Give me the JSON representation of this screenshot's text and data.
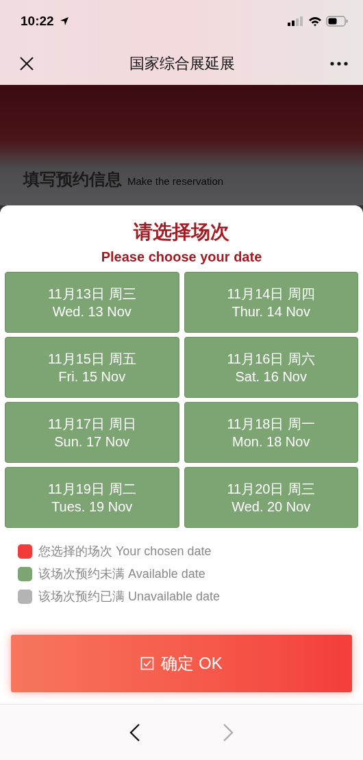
{
  "status_bar": {
    "time": "10:22"
  },
  "nav": {
    "title": "国家综合展延展"
  },
  "background": {
    "heading": "填写预约信息",
    "subheading": "Make the reservation"
  },
  "sheet": {
    "title": "请选择场次",
    "subtitle": "Please choose your date",
    "dates": [
      {
        "zh": "11月13日 周三",
        "en": "Wed. 13 Nov",
        "available": true
      },
      {
        "zh": "11月14日 周四",
        "en": "Thur. 14 Nov",
        "available": true
      },
      {
        "zh": "11月15日 周五",
        "en": "Fri. 15 Nov",
        "available": true
      },
      {
        "zh": "11月16日 周六",
        "en": "Sat. 16 Nov",
        "available": true
      },
      {
        "zh": "11月17日 周日",
        "en": "Sun. 17 Nov",
        "available": true
      },
      {
        "zh": "11月18日 周一",
        "en": "Mon. 18 Nov",
        "available": true
      },
      {
        "zh": "11月19日 周二",
        "en": "Tues. 19 Nov",
        "available": true
      },
      {
        "zh": "11月20日 周三",
        "en": "Wed. 20 Nov",
        "available": true
      }
    ],
    "legend": [
      {
        "label": "您选择的场次 Your chosen date",
        "color": "#f23c3c"
      },
      {
        "label": "该场次预约未满 Available date",
        "color": "#7da473"
      },
      {
        "label": "该场次预约已满 Unavailable date",
        "color": "#b4b4b4"
      }
    ],
    "ok_button": "确定 OK"
  },
  "browser_bar": {
    "back_disabled": false,
    "forward_disabled": true
  }
}
